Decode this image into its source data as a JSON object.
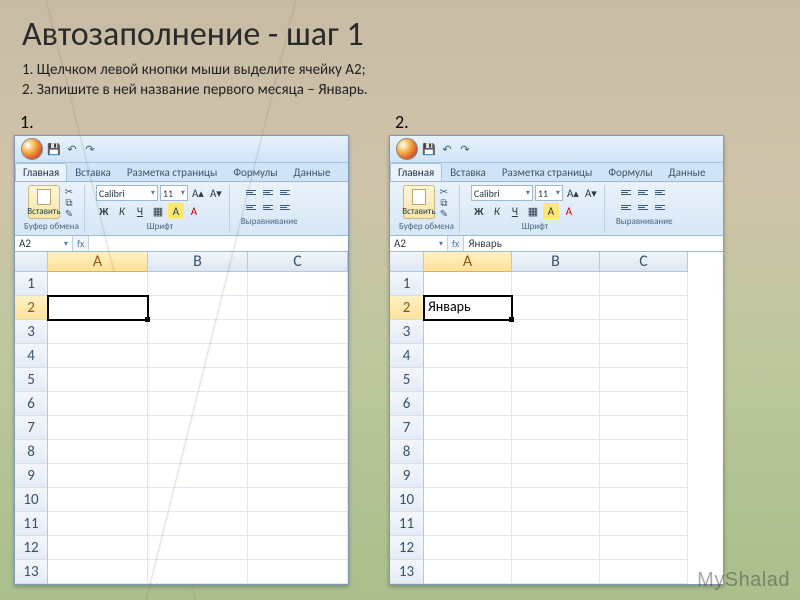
{
  "slide": {
    "title": "Автозаполнение - шаг 1",
    "step1": "1.   Щелчком левой кнопки мыши выделите ячейку A2;",
    "step2": "2.   Запишите в ней название первого месяца – Январь.",
    "label1": "1.",
    "label2": "2."
  },
  "excel": {
    "tabs": {
      "home": "Главная",
      "insert": "Вставка",
      "layout": "Разметка страницы",
      "formulas": "Формулы",
      "data": "Данные"
    },
    "groups": {
      "clipboard": "Буфер обмена",
      "font": "Шрифт",
      "alignment": "Выравнивание"
    },
    "paste_label": "Вставить",
    "font_name": "Calibri",
    "font_size": "11",
    "bold": "Ж",
    "italic": "К",
    "underline": "Ч",
    "namebox": "A2",
    "columns": [
      "A",
      "B",
      "C"
    ],
    "rows": [
      "1",
      "2",
      "3",
      "4",
      "5",
      "6",
      "7",
      "8",
      "9",
      "10",
      "11",
      "12",
      "13"
    ]
  },
  "shots": {
    "s1": {
      "fx_value": "",
      "a2_value": ""
    },
    "s2": {
      "fx_value": "Январь",
      "a2_value": "Январь"
    }
  },
  "watermark": "MyShalad"
}
